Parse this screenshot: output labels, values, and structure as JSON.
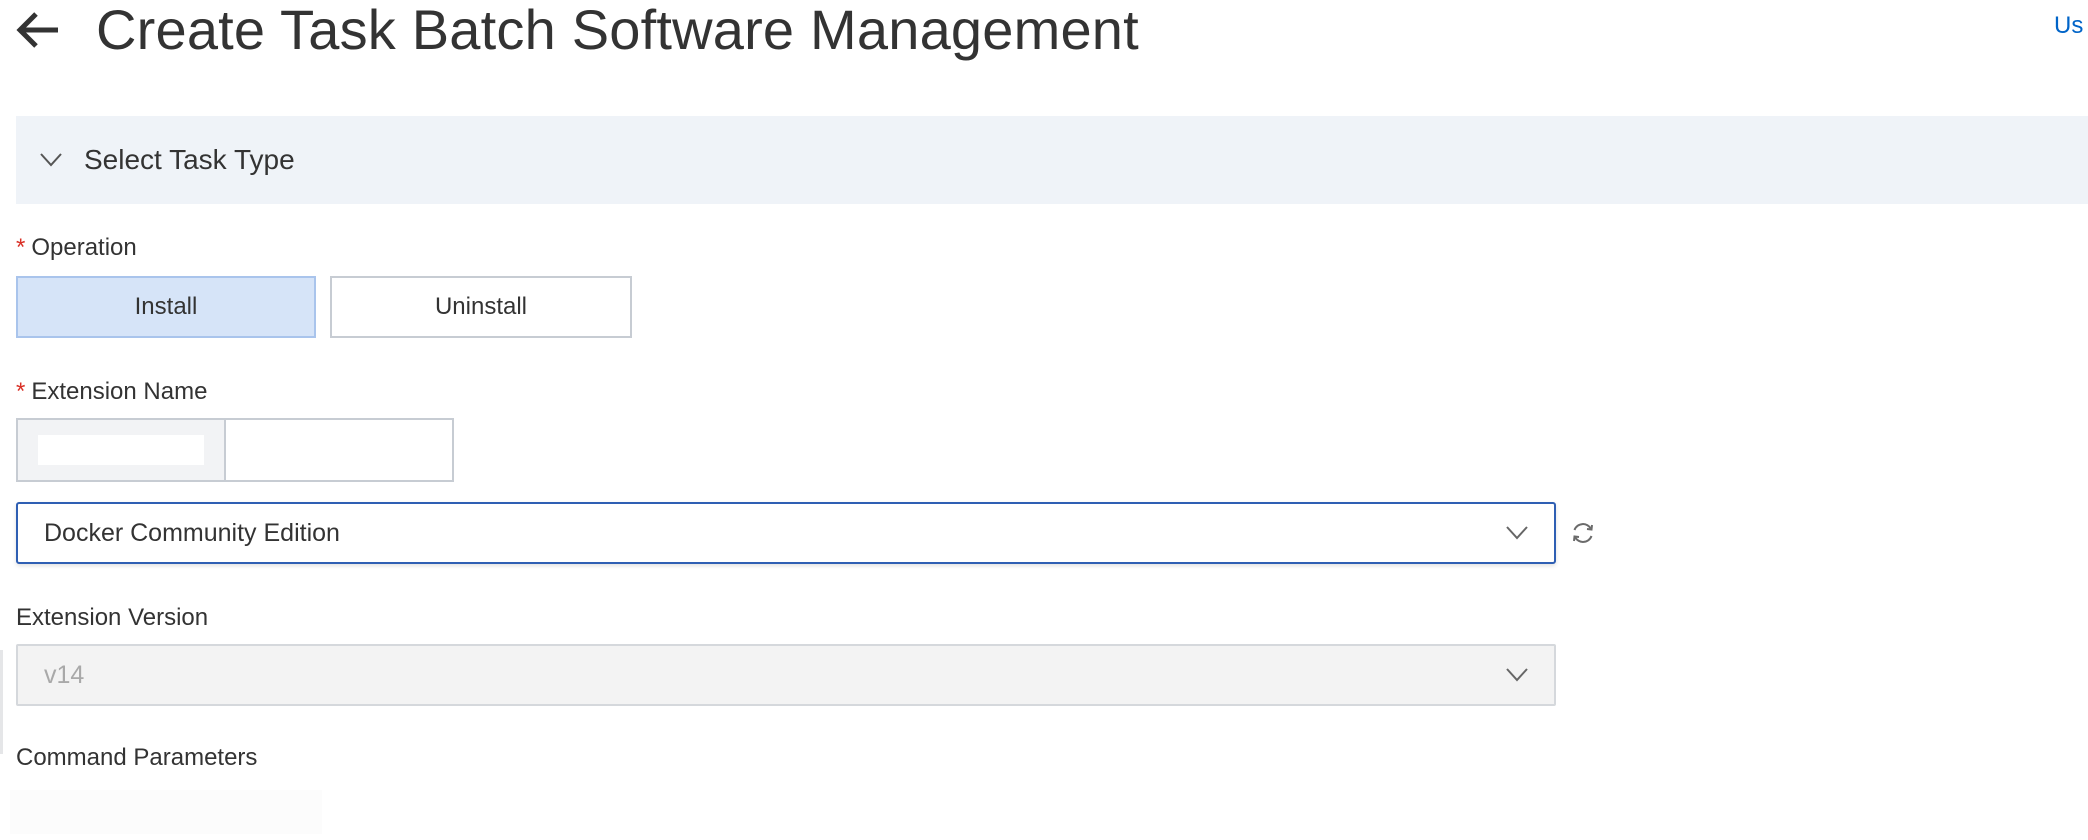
{
  "header": {
    "title": "Create Task Batch Software Management",
    "top_link": "Us"
  },
  "section": {
    "title": "Select Task Type"
  },
  "form": {
    "operation": {
      "label": "Operation",
      "required_mark": "*",
      "options": [
        "Install",
        "Uninstall"
      ],
      "selected": "Install"
    },
    "extension_name": {
      "label": "Extension Name",
      "required_mark": "*",
      "selected_value": "Docker Community Edition"
    },
    "extension_version": {
      "label": "Extension Version",
      "value": "v14"
    },
    "command_parameters": {
      "label": "Command Parameters"
    }
  },
  "icons": {
    "back": "arrow-left-icon",
    "section_toggle": "chevron-down-icon",
    "select_arrow": "chevron-down-icon",
    "refresh": "refresh-icon"
  },
  "colors": {
    "accent": "#0064c8",
    "required": "#d93026",
    "section_bg": "#eff3f8",
    "selected_bg": "#d6e4f8",
    "active_border": "#2f5fb3"
  }
}
